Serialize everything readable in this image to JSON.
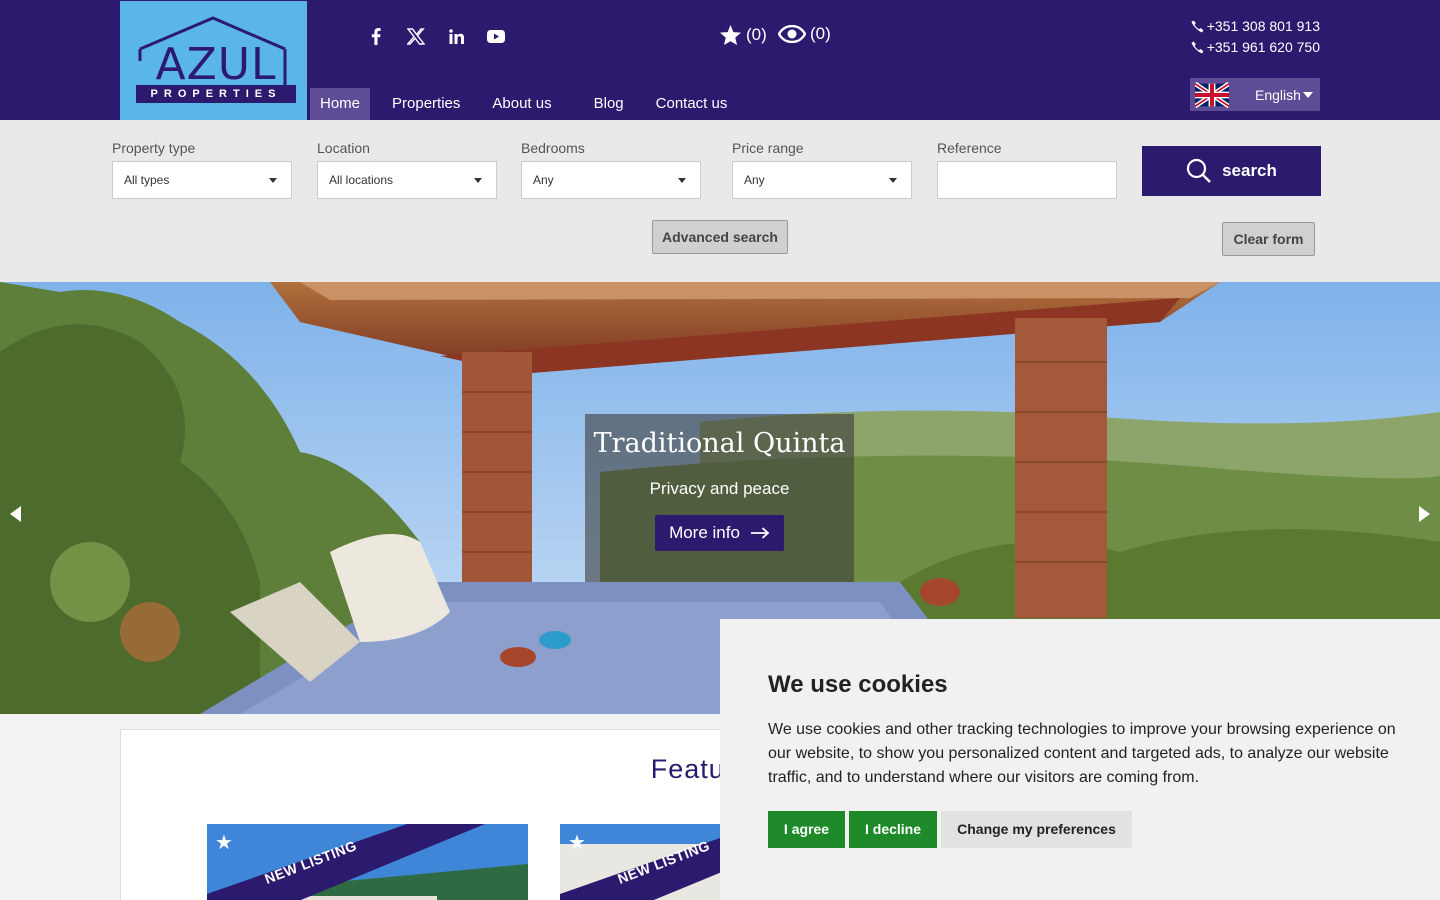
{
  "header": {
    "logo_text": "AZUL",
    "logo_subtext": "PROPERTIES",
    "social_icons": [
      "facebook-icon",
      "x-twitter-icon",
      "linkedin-icon",
      "youtube-icon"
    ],
    "favourites_count": "(0)",
    "viewed_count": "(0)",
    "phones": [
      "+351 308 801 913",
      "+351 961 620 750"
    ],
    "nav": [
      {
        "label": "Home",
        "active": true
      },
      {
        "label": "Properties",
        "active": false
      },
      {
        "label": "About us",
        "active": false
      },
      {
        "label": "Blog",
        "active": false
      },
      {
        "label": "Contact us",
        "active": false
      }
    ],
    "language": "English",
    "brand_color": "#2c1a6e",
    "nav_active_color": "#5e4c97"
  },
  "search": {
    "fields": [
      {
        "label": "Property type",
        "value": "All types"
      },
      {
        "label": "Location",
        "value": "All locations"
      },
      {
        "label": "Bedrooms",
        "value": "Any"
      },
      {
        "label": "Price range",
        "value": "Any"
      },
      {
        "label": "Reference",
        "value": ""
      }
    ],
    "search_label": "search",
    "advanced_label": "Advanced search",
    "clear_label": "Clear form"
  },
  "hero": {
    "title": "Traditional Quinta",
    "subtitle": "Privacy and peace",
    "button_label": "More info"
  },
  "featured": {
    "title": "Featured p",
    "ribbon_label": "NEW LISTING"
  },
  "cookie": {
    "title": "We use cookies",
    "text": "We use cookies and other tracking technologies to improve your browsing experience on our website, to show you personalized content and targeted ads, to analyze our website traffic, and to understand where our visitors are coming from.",
    "agree_label": "I agree",
    "decline_label": "I decline",
    "preferences_label": "Change my preferences",
    "accent_color": "#1f8a2a"
  }
}
